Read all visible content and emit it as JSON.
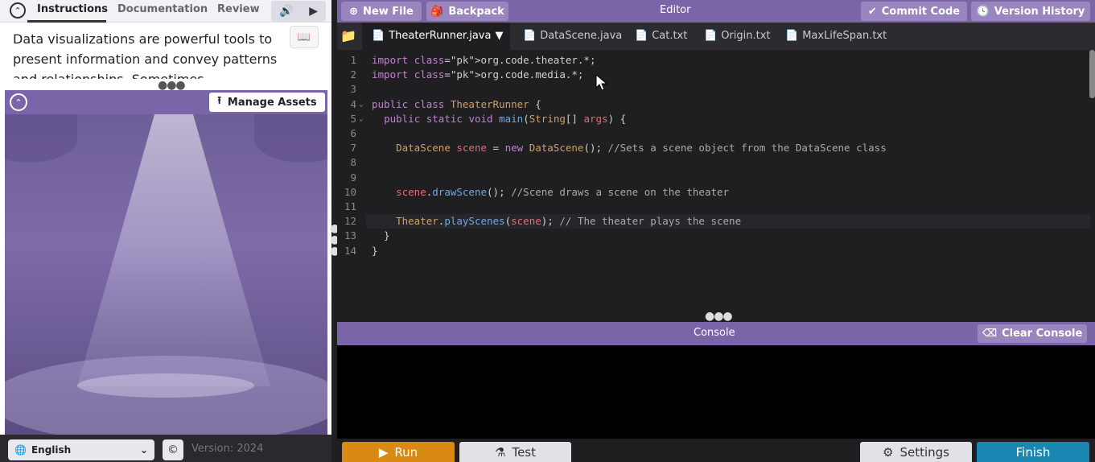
{
  "instructions_panel": {
    "tabs": [
      "Instructions",
      "Documentation",
      "Review"
    ],
    "text": "Data visualizations are powerful tools to present information and convey patterns and relationships. Sometimes visualizations are charts"
  },
  "stage": {
    "manage_assets_label": "Manage Assets"
  },
  "footer_left": {
    "language": "English",
    "version": "Version: 2024"
  },
  "toolbar": {
    "new_file": "New File",
    "backpack": "Backpack",
    "editor_label": "Editor",
    "commit_code": "Commit Code",
    "version_history": "Version History"
  },
  "file_tabs": [
    {
      "name": "TheaterRunner.java",
      "active": true
    },
    {
      "name": "DataScene.java",
      "active": false
    },
    {
      "name": "Cat.txt",
      "active": false
    },
    {
      "name": "Origin.txt",
      "active": false
    },
    {
      "name": "MaxLifeSpan.txt",
      "active": false
    }
  ],
  "code_lines": [
    "import org.code.theater.*;",
    "import org.code.media.*;",
    "",
    "public class TheaterRunner {",
    "  public static void main(String[] args) {",
    "",
    "    DataScene scene = new DataScene(); //Sets a scene object from the DataScene class",
    "",
    "",
    "    scene.drawScene(); //Scene draws a scene on the theater",
    "",
    "    Theater.playScenes(scene); // The theater plays the scene",
    "  }",
    "}"
  ],
  "console": {
    "label": "Console",
    "clear_label": "Clear Console"
  },
  "footer_right": {
    "run": "Run",
    "test": "Test",
    "settings": "Settings",
    "finish": "Finish"
  },
  "colors": {
    "accent_purple": "#7a65a8",
    "run_orange": "#d98a14",
    "finish_blue": "#1a87b3",
    "editor_bg": "#1f1f22"
  }
}
